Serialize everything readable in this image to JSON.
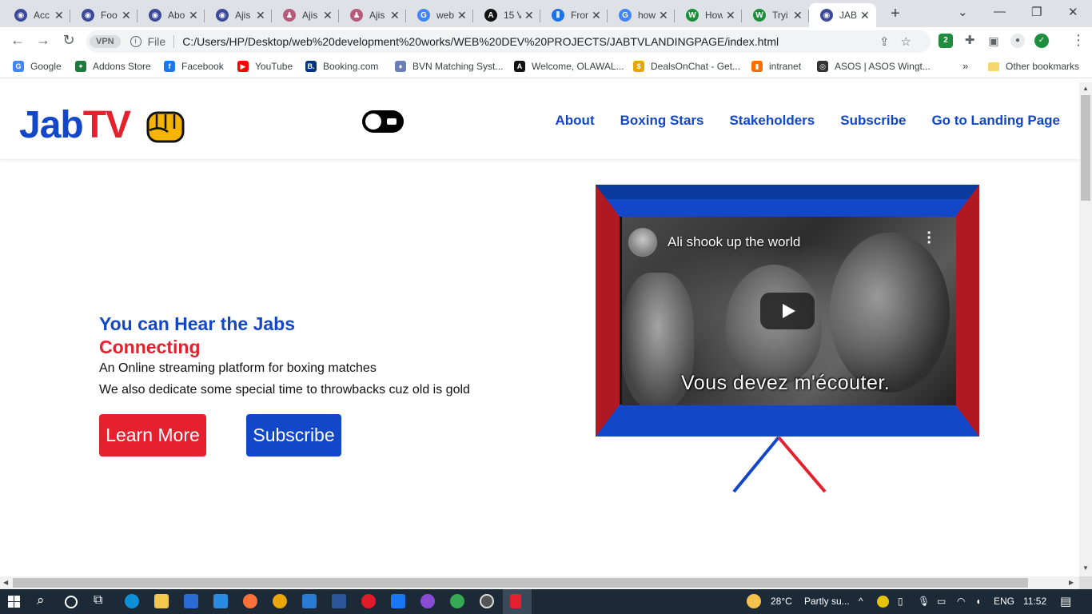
{
  "browser": {
    "tabs": [
      {
        "title": "Acc",
        "fav_color": "#3c4a9a",
        "glyph": "◉"
      },
      {
        "title": "Foo",
        "fav_color": "#3c4a9a",
        "glyph": "◉"
      },
      {
        "title": "Abo",
        "fav_color": "#3c4a9a",
        "glyph": "◉"
      },
      {
        "title": "Ajis",
        "fav_color": "#3c4a9a",
        "glyph": "◉"
      },
      {
        "title": "Ajis",
        "fav_color": "#b85a7a",
        "glyph": "♟"
      },
      {
        "title": "Ajis",
        "fav_color": "#b85a7a",
        "glyph": "♟"
      },
      {
        "title": "web",
        "fav_color": "#4285f4",
        "glyph": "G"
      },
      {
        "title": "15 V",
        "fav_color": "#111111",
        "glyph": "A"
      },
      {
        "title": "Fron",
        "fav_color": "#1a73e8",
        "glyph": "⦀"
      },
      {
        "title": "how",
        "fav_color": "#4285f4",
        "glyph": "G"
      },
      {
        "title": "How",
        "fav_color": "#1d8f3a",
        "glyph": "W"
      },
      {
        "title": "Tryi",
        "fav_color": "#1d8f3a",
        "glyph": "W"
      },
      {
        "title": "JAB",
        "fav_color": "#3c4a9a",
        "glyph": "◉"
      }
    ],
    "window_controls": {
      "minimize": "—",
      "restore": "❐",
      "close": "✕",
      "tab_search": "⌄"
    },
    "new_tab_glyph": "+",
    "vpn_label": "VPN",
    "file_label": "File",
    "url": "C:/Users/HP/Desktop/web%20development%20works/WEB%20DEV%20PROJECTS/JABTVLANDINGPAGE/index.html",
    "extensions_badge": "2",
    "bookmarks": [
      {
        "label": "Google",
        "color": "#4285f4",
        "glyph": "G"
      },
      {
        "label": "Addons Store",
        "color": "#1d7a3a",
        "glyph": "✦"
      },
      {
        "label": "Facebook",
        "color": "#1877f2",
        "glyph": "f"
      },
      {
        "label": "YouTube",
        "color": "#ff0000",
        "glyph": "▶"
      },
      {
        "label": "Booking.com",
        "color": "#003580",
        "glyph": "B."
      },
      {
        "label": "BVN Matching Syst...",
        "color": "#6a7fb8",
        "glyph": "♦"
      },
      {
        "label": "Welcome, OLAWAL...",
        "color": "#111111",
        "glyph": "A"
      },
      {
        "label": "DealsOnChat - Get...",
        "color": "#e8a400",
        "glyph": "$"
      },
      {
        "label": "intranet",
        "color": "#ff6d00",
        "glyph": "▮"
      },
      {
        "label": "ASOS | ASOS Wingt...",
        "color": "#333333",
        "glyph": "◎"
      }
    ],
    "more_bookmarks": "»",
    "other_bookmarks": "Other bookmarks"
  },
  "site": {
    "logo_part1": "Jab",
    "logo_part2": "TV",
    "nav": [
      "About",
      "Boxing Stars",
      "Stakeholders",
      "Subscribe",
      "Go to Landing Page"
    ],
    "hero": {
      "title_line1": "You can Hear the Jabs",
      "title_line2": "Connecting",
      "para1": "An Online streaming platform for boxing matches",
      "para2": "We also dedicate some special time to throwbacks cuz old is gold",
      "btn_learn": "Learn More",
      "btn_subscribe": "Subscribe"
    },
    "video": {
      "title": "Ali shook up the world",
      "subtitle": "Vous devez m'écouter."
    },
    "colors": {
      "blue": "#1147c8",
      "red": "#e4212d"
    }
  },
  "taskbar": {
    "weather_temp": "28°C",
    "weather_text": "Partly su...",
    "language": "ENG",
    "time": "11:52"
  }
}
